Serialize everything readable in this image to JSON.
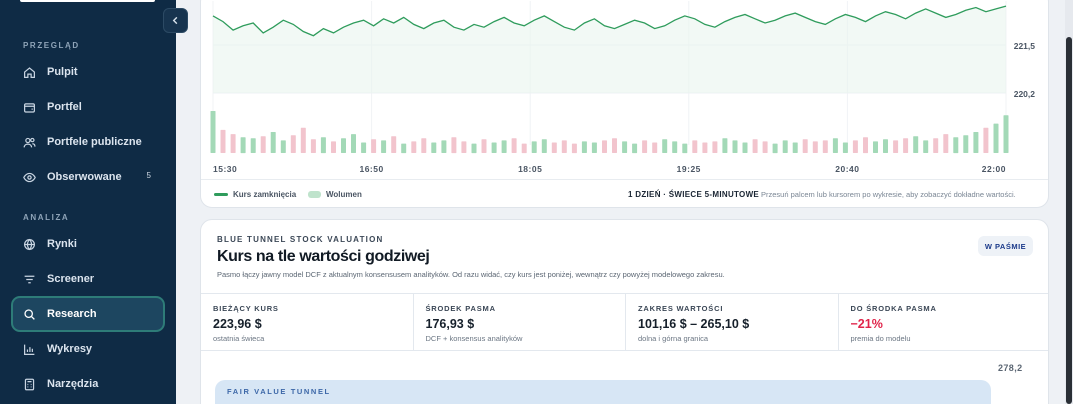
{
  "sidebar": {
    "sections": [
      {
        "title": "PRZEGLĄD",
        "items": [
          {
            "label": "Pulpit",
            "icon": "home-icon"
          },
          {
            "label": "Portfel",
            "icon": "wallet-icon"
          },
          {
            "label": "Portfele publiczne",
            "icon": "users-icon"
          },
          {
            "label": "Obserwowane",
            "icon": "eye-icon",
            "badge": "5"
          }
        ]
      },
      {
        "title": "ANALIZA",
        "items": [
          {
            "label": "Rynki",
            "icon": "globe-icon"
          },
          {
            "label": "Screener",
            "icon": "filter-icon"
          },
          {
            "label": "Research",
            "icon": "search-icon",
            "active": true
          },
          {
            "label": "Wykresy",
            "icon": "bar-chart-icon"
          },
          {
            "label": "Narzędzia",
            "icon": "calculator-icon"
          }
        ]
      }
    ],
    "collapse_icon": "chevron-left-icon"
  },
  "chart": {
    "legend": {
      "close": "Kurs zamknięcia",
      "volume": "Wolumen"
    },
    "timeframe": "1 DZIEŃ · ŚWIECE 5-MINUTOWE",
    "hint": "Przesuń palcem lub kursorem po wykresie, aby zobaczyć dokładne wartości.",
    "colors": {
      "line": "#2f9c5c",
      "area": "#eaf5ee",
      "vol_up": "#a3d9b7",
      "vol_down": "#f2c4cd"
    }
  },
  "chart_data": {
    "type": "line",
    "x_ticks": [
      "15:30",
      "16:50",
      "18:05",
      "19:25",
      "20:40",
      "22:00"
    ],
    "y_ticks": [
      "221,5",
      "220,2"
    ],
    "series": [
      {
        "values": [
          223.4,
          223.0,
          222.4,
          222.7,
          222.9,
          222.2,
          222.6,
          223.1,
          222.8,
          222.3,
          222.0,
          222.5,
          222.2,
          222.6,
          222.9,
          223.1,
          222.7,
          223.2,
          222.9,
          223.3,
          222.8,
          222.5,
          222.9,
          223.1,
          222.6,
          222.4,
          222.8,
          222.6,
          223.0,
          223.3,
          222.9,
          222.7,
          223.1,
          223.4,
          223.0,
          222.6,
          222.4,
          222.9,
          223.2,
          222.7,
          222.5,
          222.8,
          223.1,
          222.9,
          222.5,
          222.7,
          223.1,
          223.4,
          223.2,
          222.8,
          222.6,
          223.0,
          223.3,
          223.5,
          223.2,
          222.9,
          223.1,
          223.4,
          223.6,
          223.3,
          223.0,
          222.8,
          223.2,
          223.5,
          223.3,
          223.0,
          223.4,
          223.7,
          223.5,
          223.2,
          223.6,
          223.9,
          223.6,
          223.3,
          223.5,
          223.8,
          224.0,
          223.7,
          223.9,
          224.1
        ]
      },
      {
        "values": [
          40,
          22,
          18,
          15,
          14,
          16,
          20,
          12,
          17,
          24,
          13,
          15,
          11,
          14,
          18,
          10,
          13,
          12,
          16,
          9,
          11,
          14,
          10,
          12,
          15,
          11,
          9,
          13,
          10,
          12,
          14,
          9,
          11,
          13,
          10,
          12,
          9,
          11,
          10,
          12,
          14,
          11,
          9,
          12,
          10,
          13,
          11,
          9,
          12,
          10,
          11,
          14,
          12,
          10,
          13,
          11,
          9,
          12,
          10,
          13,
          11,
          12,
          14,
          10,
          12,
          15,
          11,
          13,
          12,
          14,
          16,
          12,
          14,
          18,
          15,
          17,
          20,
          24,
          28,
          36
        ]
      }
    ]
  },
  "valuation": {
    "eyebrow": "BLUE TUNNEL STOCK VALUATION",
    "title": "Kurs na tle wartości godziwej",
    "subtitle": "Pasmo łączy jawny model DCF z aktualnym konsensusem analityków. Od razu widać, czy kurs jest poniżej, wewnątrz czy powyżej modelowego zakresu.",
    "badge": "W PAŚMIE",
    "stats": [
      {
        "label": "BIEŻĄCY KURS",
        "value": "223,96 $",
        "sub": "ostatnia świeca"
      },
      {
        "label": "ŚRODEK PASMA",
        "value": "176,93 $",
        "sub": "DCF + konsensus analityków"
      },
      {
        "label": "ZAKRES WARTOŚCI",
        "value": "101,16 $ – 265,10 $",
        "sub": "dolna i górna granica"
      },
      {
        "label": "DO ŚRODKA PASMA",
        "value": "−21%",
        "sub": "premia do modelu",
        "negative": true
      }
    ],
    "axis_top": "278,2",
    "tunnel_label": "FAIR VALUE TUNNEL"
  }
}
